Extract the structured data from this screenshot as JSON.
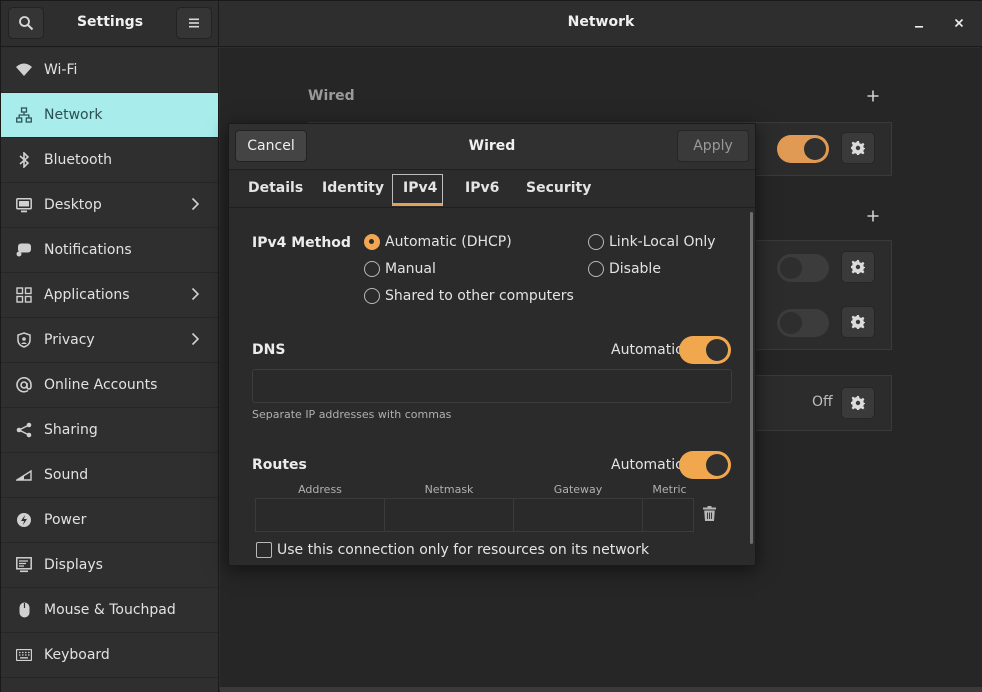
{
  "window": {
    "sidebar_title": "Settings",
    "main_title": "Network"
  },
  "sidebar": {
    "items": [
      {
        "label": "Wi-Fi",
        "icon": "wifi-icon",
        "chevron": false
      },
      {
        "label": "Network",
        "icon": "network-icon",
        "chevron": false,
        "active": true
      },
      {
        "label": "Bluetooth",
        "icon": "bluetooth-icon",
        "chevron": false
      },
      {
        "label": "Desktop",
        "icon": "desktop-icon",
        "chevron": true
      },
      {
        "label": "Notifications",
        "icon": "notifications-icon",
        "chevron": false
      },
      {
        "label": "Applications",
        "icon": "applications-icon",
        "chevron": true
      },
      {
        "label": "Privacy",
        "icon": "privacy-icon",
        "chevron": true
      },
      {
        "label": "Online Accounts",
        "icon": "online-accounts-icon",
        "chevron": false
      },
      {
        "label": "Sharing",
        "icon": "sharing-icon",
        "chevron": false
      },
      {
        "label": "Sound",
        "icon": "sound-icon",
        "chevron": false
      },
      {
        "label": "Power",
        "icon": "power-icon",
        "chevron": false
      },
      {
        "label": "Displays",
        "icon": "displays-icon",
        "chevron": false
      },
      {
        "label": "Mouse & Touchpad",
        "icon": "mouse-icon",
        "chevron": false
      },
      {
        "label": "Keyboard",
        "icon": "keyboard-icon",
        "chevron": false
      }
    ]
  },
  "background": {
    "wired_label": "Wired",
    "proxy_state": "Off"
  },
  "dialog": {
    "cancel_label": "Cancel",
    "title": "Wired",
    "apply_label": "Apply",
    "tabs": [
      "Details",
      "Identity",
      "IPv4",
      "IPv6",
      "Security"
    ],
    "active_tab": "IPv4",
    "ipv4_method_label": "IPv4 Method",
    "methods": {
      "automatic": "Automatic (DHCP)",
      "manual": "Manual",
      "shared": "Shared to other computers",
      "link_local": "Link-Local Only",
      "disable": "Disable"
    },
    "selected_method": "Automatic (DHCP)",
    "dns": {
      "label": "DNS",
      "auto_label": "Automatic",
      "auto_on": true,
      "value": "",
      "hint": "Separate IP addresses with commas"
    },
    "routes": {
      "label": "Routes",
      "auto_label": "Automatic",
      "auto_on": true,
      "columns": [
        "Address",
        "Netmask",
        "Gateway",
        "Metric"
      ]
    },
    "only_resources_label": "Use this connection only for resources on its network",
    "only_resources_checked": false
  },
  "colors": {
    "accent": "#f0a654",
    "selection": "#a8ecec"
  }
}
